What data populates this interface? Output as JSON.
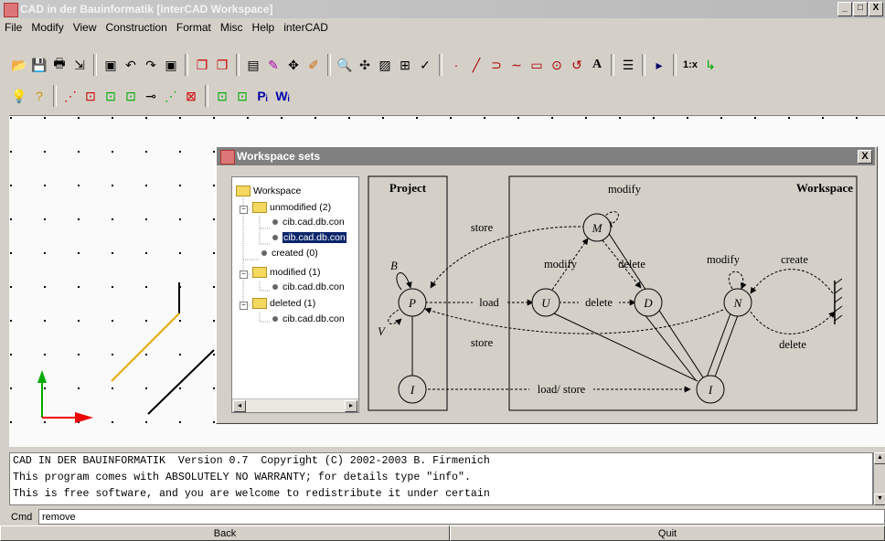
{
  "window": {
    "title": "CAD in der Bauinformatik [interCAD Workspace]",
    "buttons": [
      "_",
      "□",
      "X"
    ]
  },
  "menu": [
    "File",
    "Modify",
    "View",
    "Construction",
    "Format",
    "Misc",
    "Help",
    "interCAD"
  ],
  "command_output": [
    "CAD IN DER BAUINFORMATIK  Version 0.7  Copyright (C) 2002-2003 B. Firmenich",
    "This program comes with ABSOLUTELY NO WARRANTY; for details type \"info\".",
    "This is free software, and you are welcome to redistribute it under certain"
  ],
  "cmd": {
    "label": "Cmd",
    "value": "remove"
  },
  "bottom_buttons": {
    "back": "Back",
    "quit": "Quit"
  },
  "dialog": {
    "title": "Workspace sets",
    "close": "X",
    "tree": {
      "root": "Workspace",
      "unmodified": "unmodified (2)",
      "unmodified_items": [
        "cib.cad.db.con",
        "cib.cad.db.con"
      ],
      "created": "created (0)",
      "modified": "modified (1)",
      "modified_items": [
        "cib.cad.db.con"
      ],
      "deleted": "deleted (1)",
      "deleted_items": [
        "cib.cad.db.con"
      ]
    },
    "diagram": {
      "project_label": "Project",
      "workspace_label": "Workspace",
      "nodes": {
        "P": "P",
        "I_left": "I",
        "U": "U",
        "D": "D",
        "M": "M",
        "N": "N",
        "I_right": "I"
      },
      "labels": {
        "store_top": "store",
        "store_bottom": "store",
        "load": "load",
        "delete_ud": "delete",
        "modify_m_top": "modify",
        "modify_um": "modify",
        "delete_md": "delete",
        "modify_n": "modify",
        "create": "create",
        "delete_right": "delete",
        "load_store": "load/ store",
        "B": "B",
        "V": "V"
      }
    }
  }
}
